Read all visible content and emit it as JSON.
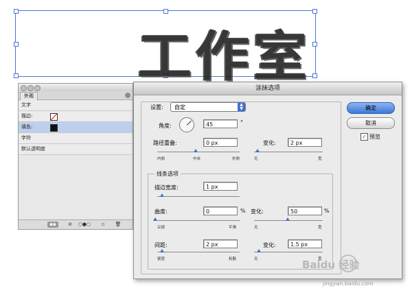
{
  "artwork": {
    "text": "工作室"
  },
  "appearance_panel": {
    "tab_label": "外观",
    "rows": [
      {
        "label": "文字"
      },
      {
        "label": "描边:"
      },
      {
        "label": "填色:"
      },
      {
        "label": "字符"
      },
      {
        "label": "默认透明度"
      }
    ],
    "bottom_buttons": [
      "▪▪",
      "⊘",
      "○●○",
      "▫",
      "🗑"
    ]
  },
  "dialog": {
    "title": "涂抹选项",
    "settings_label": "设置:",
    "settings_value": "自定",
    "angle_label": "角度:",
    "angle_value": "45",
    "angle_unit": "°",
    "path_overlap_label": "路径重叠:",
    "path_overlap_value": "0 px",
    "path_overlap_min": "内侧",
    "path_overlap_mid": "中央",
    "path_overlap_max": "外侧",
    "variation1_label": "变化:",
    "variation1_value": "2 px",
    "variation1_min": "无",
    "variation1_max": "宽",
    "line_options_label": "线条选项",
    "stroke_width_label": "描边宽度:",
    "stroke_width_value": "1 px",
    "curviness_label": "曲度:",
    "curviness_value": "0",
    "curviness_unit": "%",
    "curviness_min": "尖锐",
    "curviness_max": "平滑",
    "variation2_label": "变化:",
    "variation2_value": "50",
    "variation2_unit": "%",
    "variation2_min": "无",
    "variation2_max": "宽",
    "spacing_label": "间距:",
    "spacing_value": "2 px",
    "spacing_min": "紧密",
    "spacing_max": "松散",
    "variation3_label": "变化:",
    "variation3_value": "1.5 px",
    "variation3_min": "无",
    "variation3_max": "宽",
    "ok_label": "确定",
    "cancel_label": "取消",
    "preview_label": "预览",
    "preview_checked": true
  },
  "watermark": {
    "brand": "Baidu 经验",
    "url": "jingyan.baidu.com"
  }
}
